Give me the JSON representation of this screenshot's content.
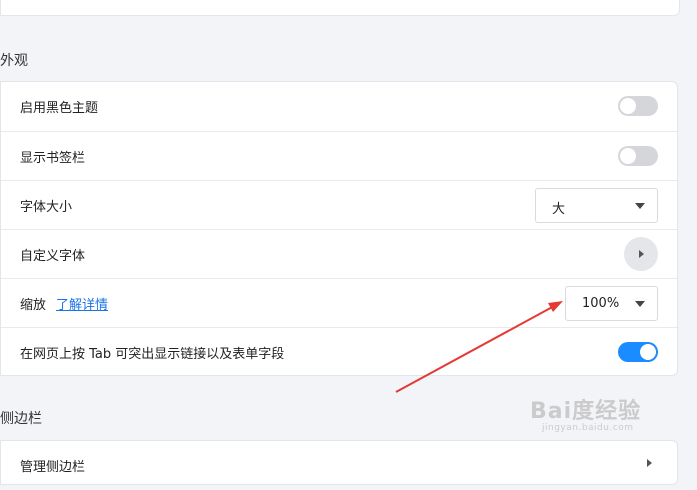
{
  "appearance": {
    "section_title": "外观",
    "rows": [
      {
        "label": "启用黑色主题",
        "control": "toggle",
        "on": false
      },
      {
        "label": "显示书签栏",
        "control": "toggle",
        "on": false
      },
      {
        "label": "字体大小",
        "control": "select",
        "value": "大"
      },
      {
        "label": "自定义字体",
        "control": "chevron"
      },
      {
        "label": "缩放",
        "link": "了解详情",
        "control": "select",
        "value": "100%"
      },
      {
        "label": "在网页上按 Tab 可突出显示链接以及表单字段",
        "control": "toggle",
        "on": true
      }
    ]
  },
  "sidebar": {
    "section_title": "侧边栏",
    "rows": [
      {
        "label": "管理侧边栏",
        "control": "chevron"
      }
    ]
  },
  "watermark": {
    "text": "Bai度经验",
    "sub": "jingyan.baidu.com"
  },
  "colors": {
    "accent": "#1a8cff",
    "link": "#1a73e8",
    "annotation_arrow": "#e53935",
    "toggle_off": "#d4d6da"
  },
  "icons": {
    "select_caret": "caret-down-icon",
    "row_chevron": "chevron-right-icon"
  }
}
